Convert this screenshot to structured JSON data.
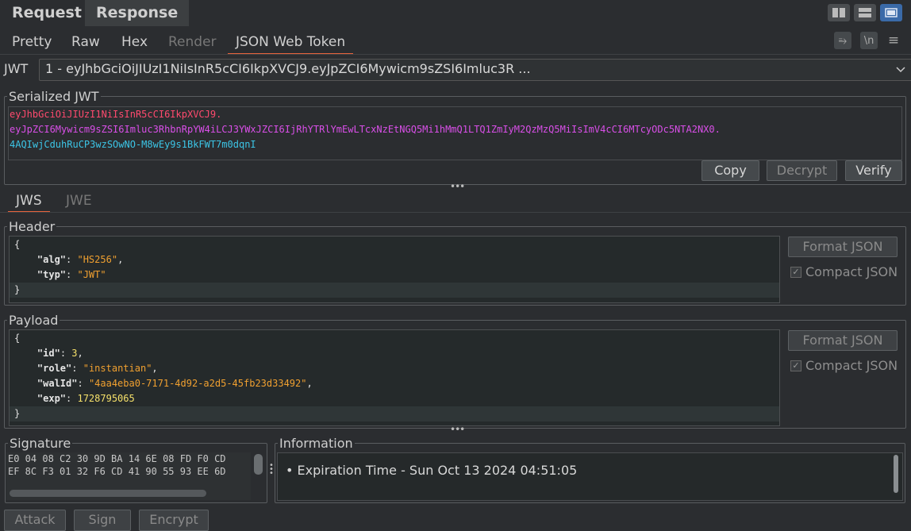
{
  "top_tabs": {
    "request": "Request",
    "response": "Response"
  },
  "sub_tabs": {
    "pretty": "Pretty",
    "raw": "Raw",
    "hex": "Hex",
    "render": "Render",
    "jwt": "JSON Web Token"
  },
  "tools": {
    "wrap": "⥱",
    "newline": "\\n",
    "menu": "≡"
  },
  "jwt_selector": {
    "label": "JWT",
    "value": "1 - eyJhbGciOiJIUzI1NiIsInR5cCI6IkpXVCJ9.eyJpZCI6Mywicm9sZSI6Imluc3R ..."
  },
  "serialized": {
    "title": "Serialized JWT",
    "header_part": "eyJhbGciOiJIUzI1NiIsInR5cCI6IkpXVCJ9.",
    "payload_part": "eyJpZCI6Mywicm9sZSI6Imluc3RhbnRpYW4iLCJ3YWxJZCI6IjRhYTRlYmEwLTcxNzEtNGQ5Mi1hMmQ1LTQ1ZmIyM2QzMzQ5MiIsImV4cCI6MTcyODc5NTA2NX0.",
    "signature_part": "4AQIwjCduhRuCP3wzSOwNO-M8wEy9s1BkFWT7m0dqnI",
    "copy": "Copy",
    "decrypt": "Decrypt",
    "verify": "Verify"
  },
  "mode_tabs": {
    "jws": "JWS",
    "jwe": "JWE"
  },
  "header_section": {
    "title": "Header",
    "open": "{",
    "close": "}",
    "alg_key": "\"alg\"",
    "alg_val": "\"HS256\"",
    "typ_key": "\"typ\"",
    "typ_val": "\"JWT\"",
    "format": "Format JSON",
    "compact": "Compact JSON"
  },
  "payload_section": {
    "title": "Payload",
    "open": "{",
    "close": "}",
    "id_key": "\"id\"",
    "id_val": "3",
    "role_key": "\"role\"",
    "role_val": "\"instantian\"",
    "walid_key": "\"walId\"",
    "walid_val": "\"4aa4eba0-7171-4d92-a2d5-45fb23d33492\"",
    "exp_key": "\"exp\"",
    "exp_val": "1728795065",
    "format": "Format JSON",
    "compact": "Compact JSON"
  },
  "signature": {
    "title": "Signature",
    "row1": "E0 04 08 C2 30 9D BA 14 6E 08 FD F0 CD",
    "row2": "EF 8C F3 01 32 F6 CD 41 90 55 93 EE 6D"
  },
  "information": {
    "title": "Information",
    "item": "• Expiration Time - Sun Oct 13 2024 04:51:05"
  },
  "actions": {
    "attack": "Attack",
    "sign": "Sign",
    "encrypt": "Encrypt"
  },
  "colors": {
    "header_part": "#ff4a6e",
    "payload_part": "#d94fe8",
    "signature_part": "#3cc5e6",
    "accent": "#e8643c"
  }
}
